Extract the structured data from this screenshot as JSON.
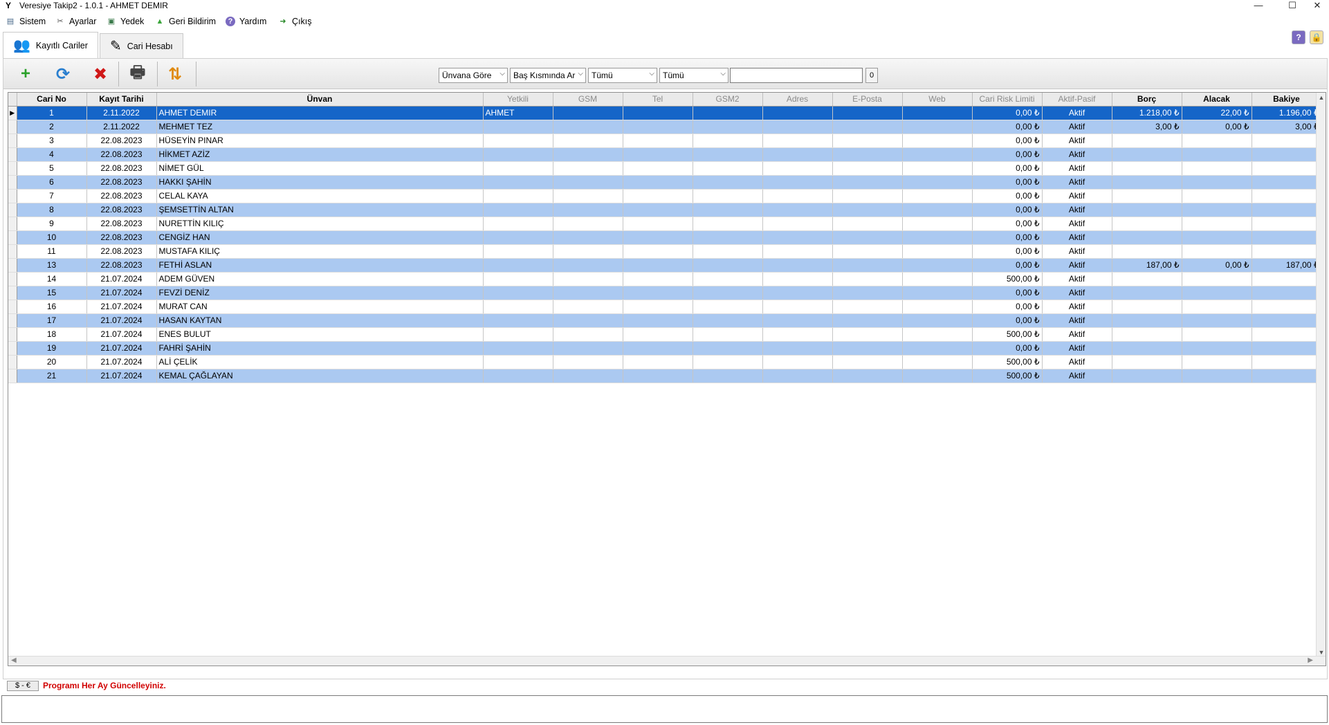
{
  "window": {
    "title": "Veresiye Takip2 - 1.0.1 - AHMET DEMIR",
    "app_icon": "Y",
    "minimize": "—",
    "maximize": "☐",
    "close": "✕"
  },
  "menu": [
    {
      "label": "Sistem",
      "icon": "database-icon",
      "glyph": "▤"
    },
    {
      "label": "Ayarlar",
      "icon": "tools-icon",
      "glyph": "✂"
    },
    {
      "label": "Yedek",
      "icon": "backup-icon",
      "glyph": "▣"
    },
    {
      "label": "Geri Bildirim",
      "icon": "upload-arrow-icon",
      "glyph": "▲"
    },
    {
      "label": "Yardım",
      "icon": "help-icon",
      "glyph": "?"
    },
    {
      "label": "Çıkış",
      "icon": "exit-icon",
      "glyph": "➜"
    }
  ],
  "tabs": [
    {
      "label": "Kayıtlı Cariler",
      "icon": "users-icon",
      "glyph": "👥"
    },
    {
      "label": "Cari Hesabı",
      "icon": "pen-icon",
      "glyph": "✎"
    }
  ],
  "topright": {
    "help": "?",
    "lock": "🔒"
  },
  "toolbar": {
    "add": "+",
    "refresh": "⟳",
    "delete": "✖",
    "print": "🖶",
    "sort": "⇅"
  },
  "filters": {
    "search_by": "Ünvana Göre",
    "match_mode": "Baş Kısmında Ar",
    "filter1": "Tümü",
    "filter2": "Tümü",
    "search_value": "",
    "result_count": "0"
  },
  "columns": [
    "Cari No",
    "Kayıt Tarihi",
    "Ünvan",
    "Yetkili",
    "GSM",
    "Tel",
    "GSM2",
    "Adres",
    "E-Posta",
    "Web",
    "Cari Risk Limiti",
    "Aktif-Pasif",
    "Borç",
    "Alacak",
    "Bakiye"
  ],
  "rows": [
    {
      "no": "1",
      "date": "2.11.2022",
      "name": "AHMET DEMIR",
      "yetkili": "AHMET",
      "risk": "0,00 ₺",
      "status": "Aktif",
      "borc": "1.218,00 ₺",
      "alacak": "22,00 ₺",
      "bakiye": "1.196,00 ₺"
    },
    {
      "no": "2",
      "date": "2.11.2022",
      "name": "MEHMET TEZ",
      "yetkili": "",
      "risk": "0,00 ₺",
      "status": "Aktif",
      "borc": "3,00 ₺",
      "alacak": "0,00 ₺",
      "bakiye": "3,00 ₺"
    },
    {
      "no": "3",
      "date": "22.08.2023",
      "name": "HÜSEYİN PINAR",
      "yetkili": "",
      "risk": "0,00 ₺",
      "status": "Aktif",
      "borc": "",
      "alacak": "",
      "bakiye": ""
    },
    {
      "no": "4",
      "date": "22.08.2023",
      "name": "HİKMET AZİZ",
      "yetkili": "",
      "risk": "0,00 ₺",
      "status": "Aktif",
      "borc": "",
      "alacak": "",
      "bakiye": ""
    },
    {
      "no": "5",
      "date": "22.08.2023",
      "name": "NİMET GÜL",
      "yetkili": "",
      "risk": "0,00 ₺",
      "status": "Aktif",
      "borc": "",
      "alacak": "",
      "bakiye": ""
    },
    {
      "no": "6",
      "date": "22.08.2023",
      "name": "HAKKI ŞAHİN",
      "yetkili": "",
      "risk": "0,00 ₺",
      "status": "Aktif",
      "borc": "",
      "alacak": "",
      "bakiye": ""
    },
    {
      "no": "7",
      "date": "22.08.2023",
      "name": "CELAL KAYA",
      "yetkili": "",
      "risk": "0,00 ₺",
      "status": "Aktif",
      "borc": "",
      "alacak": "",
      "bakiye": ""
    },
    {
      "no": "8",
      "date": "22.08.2023",
      "name": "ŞEMSETTİN ALTAN",
      "yetkili": "",
      "risk": "0,00 ₺",
      "status": "Aktif",
      "borc": "",
      "alacak": "",
      "bakiye": ""
    },
    {
      "no": "9",
      "date": "22.08.2023",
      "name": "NURETTİN KILIÇ",
      "yetkili": "",
      "risk": "0,00 ₺",
      "status": "Aktif",
      "borc": "",
      "alacak": "",
      "bakiye": ""
    },
    {
      "no": "10",
      "date": "22.08.2023",
      "name": "CENGİZ HAN",
      "yetkili": "",
      "risk": "0,00 ₺",
      "status": "Aktif",
      "borc": "",
      "alacak": "",
      "bakiye": ""
    },
    {
      "no": "11",
      "date": "22.08.2023",
      "name": "MUSTAFA KILIÇ",
      "yetkili": "",
      "risk": "0,00 ₺",
      "status": "Aktif",
      "borc": "",
      "alacak": "",
      "bakiye": ""
    },
    {
      "no": "13",
      "date": "22.08.2023",
      "name": "FETHİ ASLAN",
      "yetkili": "",
      "risk": "0,00 ₺",
      "status": "Aktif",
      "borc": "187,00 ₺",
      "alacak": "0,00 ₺",
      "bakiye": "187,00 ₺"
    },
    {
      "no": "14",
      "date": "21.07.2024",
      "name": "ADEM GÜVEN",
      "yetkili": "",
      "risk": "500,00 ₺",
      "status": "Aktif",
      "borc": "",
      "alacak": "",
      "bakiye": ""
    },
    {
      "no": "15",
      "date": "21.07.2024",
      "name": "FEVZİ DENİZ",
      "yetkili": "",
      "risk": "0,00 ₺",
      "status": "Aktif",
      "borc": "",
      "alacak": "",
      "bakiye": ""
    },
    {
      "no": "16",
      "date": "21.07.2024",
      "name": "MURAT CAN",
      "yetkili": "",
      "risk": "0,00 ₺",
      "status": "Aktif",
      "borc": "",
      "alacak": "",
      "bakiye": ""
    },
    {
      "no": "17",
      "date": "21.07.2024",
      "name": "HASAN KAYTAN",
      "yetkili": "",
      "risk": "0,00 ₺",
      "status": "Aktif",
      "borc": "",
      "alacak": "",
      "bakiye": ""
    },
    {
      "no": "18",
      "date": "21.07.2024",
      "name": "ENES BULUT",
      "yetkili": "",
      "risk": "500,00 ₺",
      "status": "Aktif",
      "borc": "",
      "alacak": "",
      "bakiye": ""
    },
    {
      "no": "19",
      "date": "21.07.2024",
      "name": "FAHRİ ŞAHİN",
      "yetkili": "",
      "risk": "0,00 ₺",
      "status": "Aktif",
      "borc": "",
      "alacak": "",
      "bakiye": ""
    },
    {
      "no": "20",
      "date": "21.07.2024",
      "name": "ALİ ÇELİK",
      "yetkili": "",
      "risk": "500,00 ₺",
      "status": "Aktif",
      "borc": "",
      "alacak": "",
      "bakiye": ""
    },
    {
      "no": "21",
      "date": "21.07.2024",
      "name": "KEMAL ÇAĞLAYAN",
      "yetkili": "",
      "risk": "500,00 ₺",
      "status": "Aktif",
      "borc": "",
      "alacak": "",
      "bakiye": ""
    }
  ],
  "status": {
    "currency_button": "$ - €",
    "notice": "Programı Her Ay Güncelleyiniz."
  },
  "colors": {
    "selected_row": "#1565c8",
    "alt_row": "#abc9f1",
    "notice": "#d10000"
  }
}
